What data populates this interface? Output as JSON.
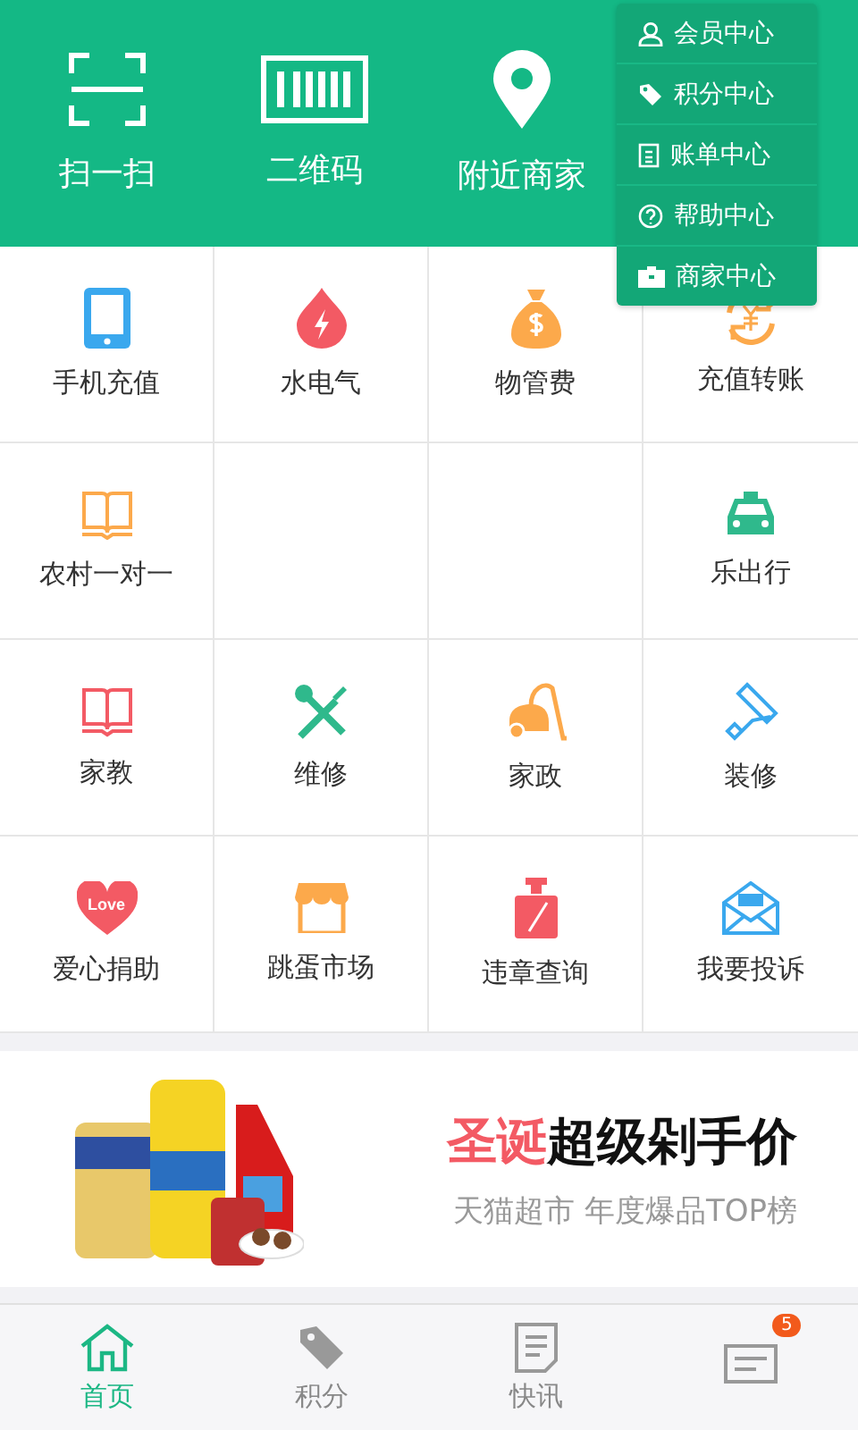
{
  "header": {
    "actions": [
      {
        "label": "扫一扫"
      },
      {
        "label": "二维码"
      },
      {
        "label": "附近商家"
      }
    ]
  },
  "menu": {
    "items": [
      {
        "label": "会员中心"
      },
      {
        "label": "积分中心"
      },
      {
        "label": "账单中心"
      },
      {
        "label": "帮助中心"
      },
      {
        "label": "商家中心"
      }
    ]
  },
  "services": [
    {
      "kind": "service",
      "label": "手机充值"
    },
    {
      "kind": "service",
      "label": "水电气"
    },
    {
      "kind": "service",
      "label": "物管费"
    },
    {
      "kind": "service",
      "label": "充值转账"
    },
    {
      "kind": "service",
      "label": "农村一对一"
    },
    {
      "kind": "empty"
    },
    {
      "kind": "empty"
    },
    {
      "kind": "service",
      "label": "乐出行"
    },
    {
      "kind": "service",
      "label": "家教"
    },
    {
      "kind": "service",
      "label": "维修"
    },
    {
      "kind": "service",
      "label": "家政"
    },
    {
      "kind": "service",
      "label": "装修"
    },
    {
      "kind": "service",
      "label": "爱心捐助",
      "icon_text": "Love"
    },
    {
      "kind": "service",
      "label": "跳蛋市场"
    },
    {
      "kind": "service",
      "label": "违章查询"
    },
    {
      "kind": "service",
      "label": "我要投诉"
    }
  ],
  "banner": {
    "highlight": "圣诞",
    "title": "超级剁手价",
    "subtitle": "天猫超市 年度爆品TOP榜"
  },
  "tabs": [
    {
      "label": "首页",
      "selected": true
    },
    {
      "label": "积分",
      "selected": false
    },
    {
      "label": "快讯",
      "selected": false
    },
    {
      "badge": "5",
      "selected": false
    }
  ]
}
